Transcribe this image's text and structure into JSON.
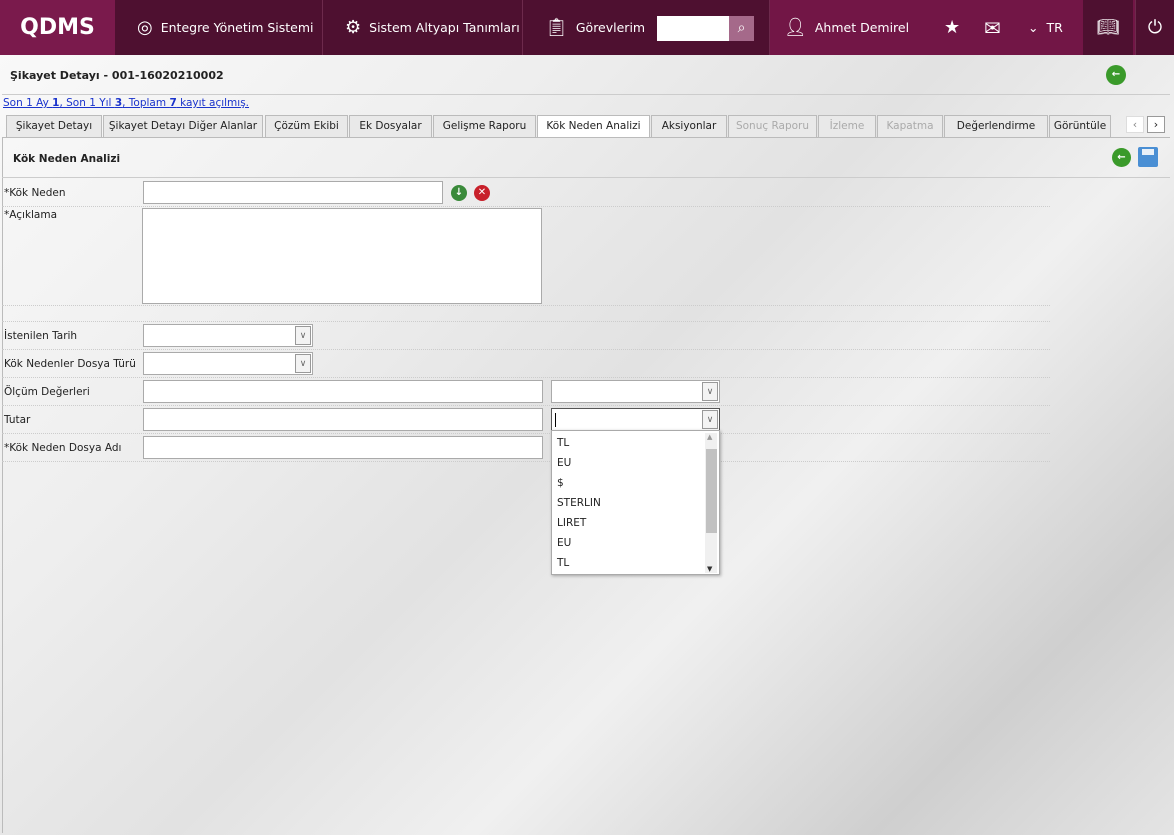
{
  "header": {
    "logo": "QDMS",
    "nav": [
      {
        "label": "Entegre Yönetim Sistemi",
        "icon": "qdms-icon"
      },
      {
        "label": "Sistem Altyapı Tanımları",
        "icon": "gear-icon"
      },
      {
        "label": "Görevlerim",
        "icon": "clipboard-icon"
      }
    ],
    "search_value": "",
    "user": "Ahmet Demirel",
    "language": "TR"
  },
  "page": {
    "title": "Şikayet Detayı - 001-16020210002",
    "stats": {
      "prefix": "Son 1 Ay ",
      "month": "1",
      "mid1": ", Son 1 Yıl ",
      "year": "3",
      "mid2": ", Toplam ",
      "total": "7",
      "suffix": " kayıt açılmış."
    }
  },
  "tabs": [
    {
      "label": "Şikayet Detayı"
    },
    {
      "label": "Şikayet Detayı Diğer Alanlar"
    },
    {
      "label": "Çözüm Ekibi"
    },
    {
      "label": "Ek Dosyalar"
    },
    {
      "label": "Gelişme Raporu"
    },
    {
      "label": "Kök Neden Analizi",
      "active": true
    },
    {
      "label": "Aksiyonlar"
    },
    {
      "label": "Sonuç Raporu",
      "disabled": true
    },
    {
      "label": "İzleme",
      "disabled": true
    },
    {
      "label": "Kapatma",
      "disabled": true
    },
    {
      "label": "Değerlendirme"
    },
    {
      "label": "Görüntüle"
    }
  ],
  "section": {
    "title": "Kök Neden Analizi"
  },
  "form": {
    "kok_neden": "*Kök Neden",
    "aciklama": "*Açıklama",
    "istenilen_tarih": "İstenilen Tarih",
    "dosya_turu": "Kök Nedenler Dosya Türü",
    "olcum": "Ölçüm Değerleri",
    "tutar": "Tutar",
    "dosya_adi": "*Kök Neden Dosya Adı"
  },
  "currency_options": [
    "TL",
    "EU",
    "$",
    "STERLIN",
    "LIRET",
    "EU",
    "TL"
  ]
}
